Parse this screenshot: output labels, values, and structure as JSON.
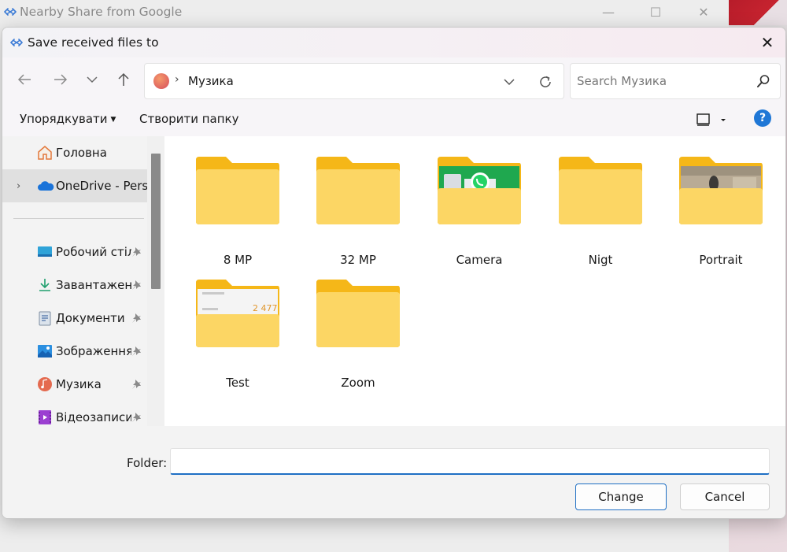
{
  "parent_window": {
    "title": "Nearby Share from Google"
  },
  "dialog": {
    "title": "Save received files to",
    "close_label": "✕"
  },
  "address": {
    "current": "Музика",
    "separator": "›"
  },
  "search": {
    "placeholder": "Search Музика"
  },
  "commands": {
    "organize": "Упорядкувати",
    "new_folder": "Створити папку",
    "help": "?"
  },
  "nav_pane": {
    "items": [
      {
        "label": "Головна",
        "icon": "home-icon",
        "pinned": false
      },
      {
        "label": "OneDrive - Perso",
        "icon": "cloud-icon",
        "pinned": false,
        "expandable": true,
        "selected": true
      },
      {
        "label": "Робочий стіл",
        "icon": "desktop-icon",
        "pinned": true
      },
      {
        "label": "Завантаження",
        "icon": "download-icon",
        "pinned": true
      },
      {
        "label": "Документи",
        "icon": "documents-icon",
        "pinned": true
      },
      {
        "label": "Зображення",
        "icon": "pictures-icon",
        "pinned": true
      },
      {
        "label": "Музика",
        "icon": "music-icon",
        "pinned": true
      },
      {
        "label": "Відеозаписи",
        "icon": "videos-icon",
        "pinned": true
      }
    ]
  },
  "folders": [
    {
      "name": "8 MP",
      "preview": "none"
    },
    {
      "name": "32 MP",
      "preview": "none"
    },
    {
      "name": "Camera",
      "preview": "whatsapp"
    },
    {
      "name": "Nigt",
      "preview": "none"
    },
    {
      "name": "Portrait",
      "preview": "photo"
    },
    {
      "name": "Test",
      "preview": "document",
      "preview_value": "2 477"
    },
    {
      "name": "Zoom",
      "preview": "none"
    }
  ],
  "footer": {
    "folder_label": "Folder:",
    "folder_value": "",
    "change_button": "Change",
    "cancel_button": "Cancel"
  },
  "colors": {
    "accent": "#1f6fc4",
    "folder_body": "#fcd664",
    "folder_back": "#f5b718"
  }
}
